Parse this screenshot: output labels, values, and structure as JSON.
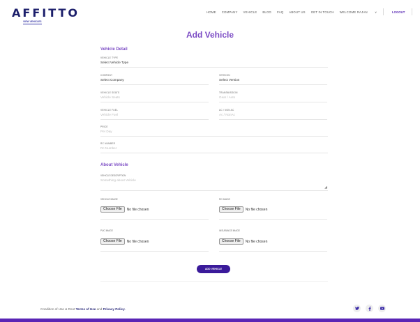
{
  "header": {
    "logo": "AFFITTO",
    "nav": [
      "HOME",
      "COMPANY",
      "VEHICLE",
      "BLOG",
      "FAQ",
      "ABOUT US",
      "GET IN TOUCH",
      "WELCOME RAJAN"
    ],
    "logout": "LOGOUT",
    "breadcrumb": "VIEW VEHICLES"
  },
  "page": {
    "title": "Add Vehicle"
  },
  "vehicle_detail": {
    "heading": "Vehicle Detail",
    "vehicle_type": {
      "label": "VEHICLE TYPE",
      "value": "Select Vehicle Type"
    },
    "company": {
      "label": "COMPANY",
      "value": "Select Company"
    },
    "version": {
      "label": "VERSION",
      "value": "Select Version"
    },
    "seats": {
      "label": "VEHICLE SEATS",
      "placeholder": "Vehicle Seats"
    },
    "transmission": {
      "label": "TRANSMISSION",
      "placeholder": "Gear / Auto"
    },
    "fuel": {
      "label": "VEHICLE FUEL",
      "placeholder": "Vehicle Fuel"
    },
    "ac": {
      "label": "AC / NON AC",
      "placeholder": "Ac / NonAc"
    },
    "price": {
      "label": "PRICE",
      "placeholder": "Per Day"
    },
    "rc_number": {
      "label": "RC NUMBER",
      "placeholder": "Rc Number"
    }
  },
  "about_vehicle": {
    "heading": "About Vehicle",
    "description": {
      "label": "VEHICLE DESCRIPTION",
      "placeholder": "Something about Vehicle"
    },
    "vehicle_image": {
      "label": "VEHICLE IMAGE",
      "button": "Choose File",
      "status": "No file chosen"
    },
    "rc_image": {
      "label": "RC IMAGE",
      "button": "Choose File",
      "status": "No file chosen"
    },
    "puc_image": {
      "label": "PUC IMAGE",
      "button": "Choose File",
      "status": "No file chosen"
    },
    "insurance_image": {
      "label": "INSURANCE IMAGE",
      "button": "Choose File",
      "status": "No file chosen"
    }
  },
  "submit": {
    "label": "ADD VEHICLE"
  },
  "footer": {
    "prefix": "Condition of Use & Root",
    "terms": "Terms of Use",
    "and": "and",
    "privacy": "Privacy Policy.",
    "social_icons": [
      "twitter-icon",
      "facebook-icon",
      "youtube-icon"
    ],
    "accent_color": "#5a25b5"
  }
}
